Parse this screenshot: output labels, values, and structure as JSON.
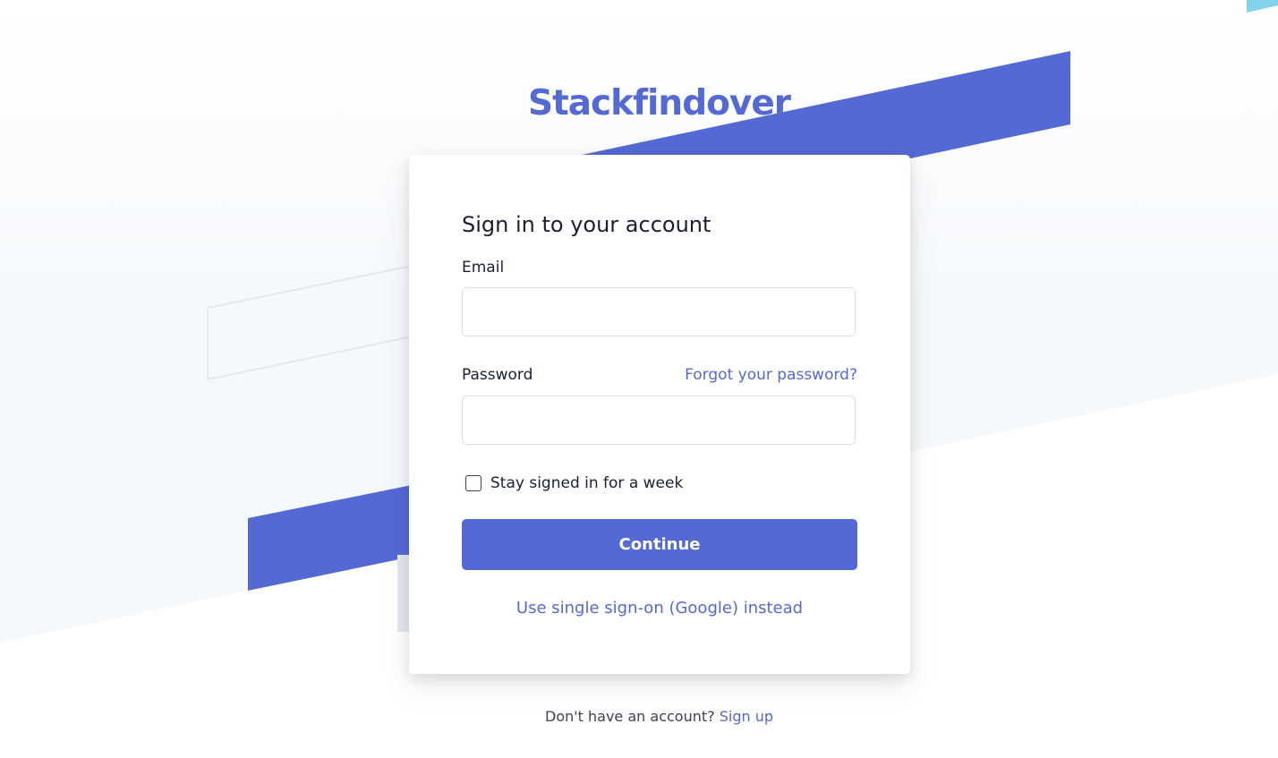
{
  "colors": {
    "brand": "#5469d4",
    "accent_cyan": "#7fd3ed"
  },
  "brand": {
    "name": "Stackfindover"
  },
  "signin": {
    "title": "Sign in to your account",
    "email_label": "Email",
    "email_value": "",
    "password_label": "Password",
    "password_value": "",
    "forgot_link": "Forgot your password?",
    "stay_signed_label": "Stay signed in for a week",
    "stay_signed_checked": false,
    "continue_label": "Continue",
    "sso_link": "Use single sign-on (Google) instead"
  },
  "footer": {
    "prompt": "Don't have an account?",
    "signup_link": "Sign up"
  }
}
